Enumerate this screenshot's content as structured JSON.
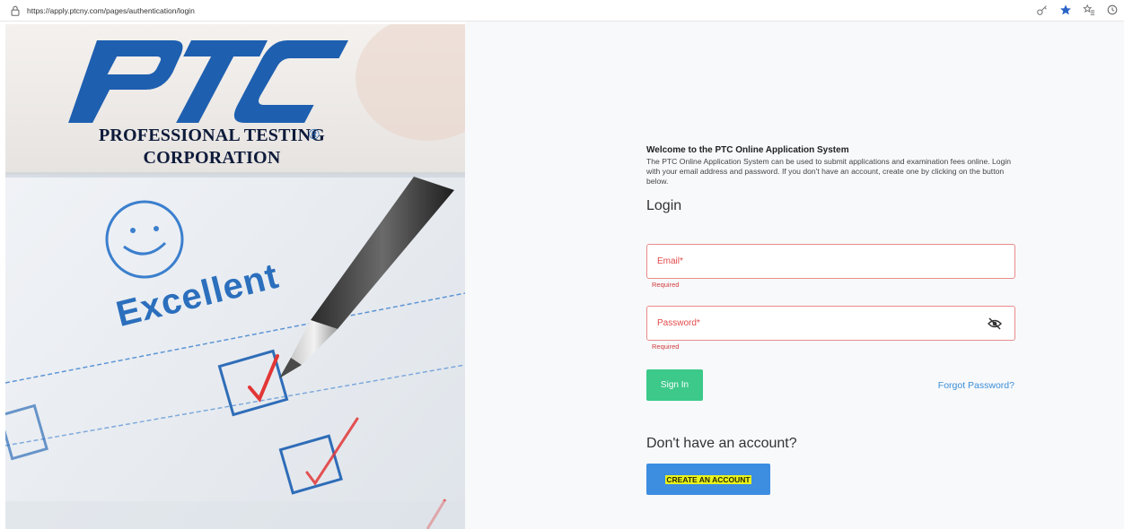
{
  "browser": {
    "url": "https://apply.ptcny.com/pages/authentication/login",
    "icons": [
      "lock-icon",
      "key-icon",
      "star-icon",
      "favorites-icon",
      "history-icon"
    ]
  },
  "hero": {
    "logo_letters": "PTC",
    "brand_line1": "PROFESSIONAL TESTING",
    "brand_line2": "CORPORATION",
    "registered": "®",
    "image_word": "Excellent"
  },
  "welcome": {
    "title": "Welcome to the PTC Online Application System",
    "text": "The PTC Online Application System can be used to submit applications and examination fees online. Login with your email address and password. If you don't have an account, create one by clicking on the button below."
  },
  "login": {
    "heading": "Login",
    "email_label": "Email*",
    "email_error": "Required",
    "password_label": "Password*",
    "password_error": "Required",
    "signin_label": "Sign In",
    "forgot_label": "Forgot Password?"
  },
  "signup": {
    "heading": "Don't have an account?",
    "create_label": "CREATE AN ACCOUNT"
  },
  "colors": {
    "primary_blue": "#3d8de0",
    "success_green": "#3cc98a",
    "error_red": "#e24a4a",
    "logo_blue": "#1e5fb0"
  }
}
